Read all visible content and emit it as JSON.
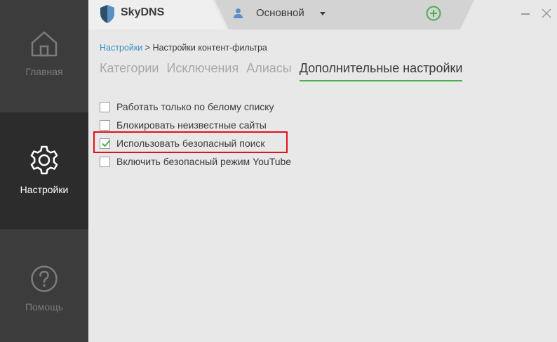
{
  "sidebar": {
    "items": [
      {
        "label": "Главная",
        "icon": "home-icon"
      },
      {
        "label": "Настройки",
        "icon": "gear-icon"
      },
      {
        "label": "Помощь",
        "icon": "help-icon"
      }
    ]
  },
  "header": {
    "brand": "SkyDNS",
    "profile_name": "Основной",
    "add_profile_icon": "plus-circle-icon",
    "accent_color": "#4cae4f"
  },
  "breadcrumb": {
    "link": "Настройки",
    "separator": ">",
    "current": "Настройки контент-фильтра"
  },
  "tabs": [
    {
      "label": "Категории",
      "active": false
    },
    {
      "label": "Исключения",
      "active": false
    },
    {
      "label": "Алиасы",
      "active": false
    },
    {
      "label": "Дополнительные настройки",
      "active": true
    }
  ],
  "options": [
    {
      "label": "Работать только по белому списку",
      "checked": false
    },
    {
      "label": "Блокировать неизвестные сайты",
      "checked": false
    },
    {
      "label": "Использовать безопасный поиск",
      "checked": true,
      "highlighted": true
    },
    {
      "label": "Включить безопасный режим YouTube",
      "checked": false
    }
  ]
}
